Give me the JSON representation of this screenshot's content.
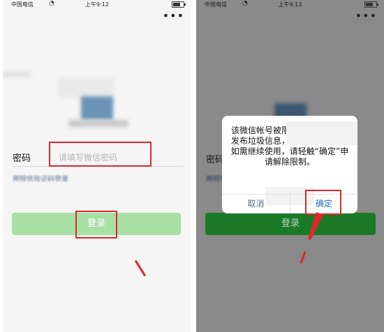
{
  "status_left": {
    "carrier": "中国电信",
    "time": "上午9:12"
  },
  "status_right": {
    "carrier": "中国电信",
    "time": "上午9:13"
  },
  "login": {
    "password_label": "密码",
    "password_placeholder": "请填写微信密码",
    "sms_login_link": "用短信验证码登录",
    "login_button": "登录"
  },
  "dialog": {
    "message": "该微信帐号被限制登录，有大量发布垃圾信息，为被限制登录，如需继续使用，请轻触“确定”申请解除限制。",
    "cancel_label": "取消",
    "confirm_label": "确定"
  },
  "colors": {
    "login_button_disabled": "#a8dfa4",
    "login_button_active": "#1b7a27",
    "highlight_red": "#e0262c"
  },
  "icons": {
    "more": "more-dots-icon",
    "wifi": "wifi-icon",
    "battery": "battery-icon"
  }
}
